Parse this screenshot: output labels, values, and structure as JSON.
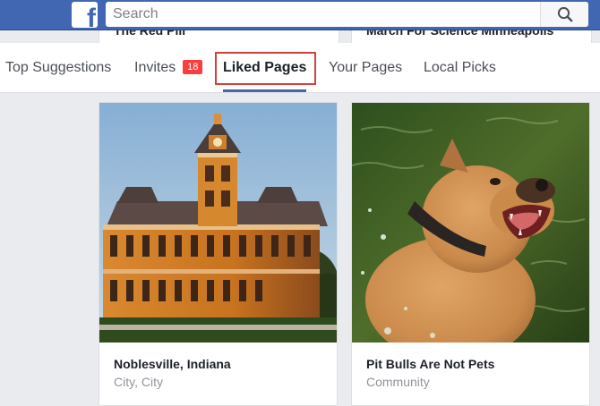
{
  "header": {
    "logo_letter": "f",
    "search_placeholder": "Search"
  },
  "behind_cards": [
    {
      "text": "The Red Pill"
    },
    {
      "text": "March For Science Minneapolis"
    }
  ],
  "tabs": [
    {
      "label": "Top Suggestions"
    },
    {
      "label": "Invites",
      "badge": "18"
    },
    {
      "label": "Liked Pages"
    },
    {
      "label": "Your Pages"
    },
    {
      "label": "Local Picks"
    }
  ],
  "active_tab": "Liked Pages",
  "cards": [
    {
      "name": "Noblesville, Indiana",
      "category": "City, City",
      "image": "courthouse-photo"
    },
    {
      "name": "Pit Bulls Are Not Pets",
      "category": "Community",
      "image": "dog-photo"
    }
  ],
  "colors": {
    "brand": "#4267b2",
    "badge": "#fa3e3e",
    "highlight": "#d43f3f"
  }
}
